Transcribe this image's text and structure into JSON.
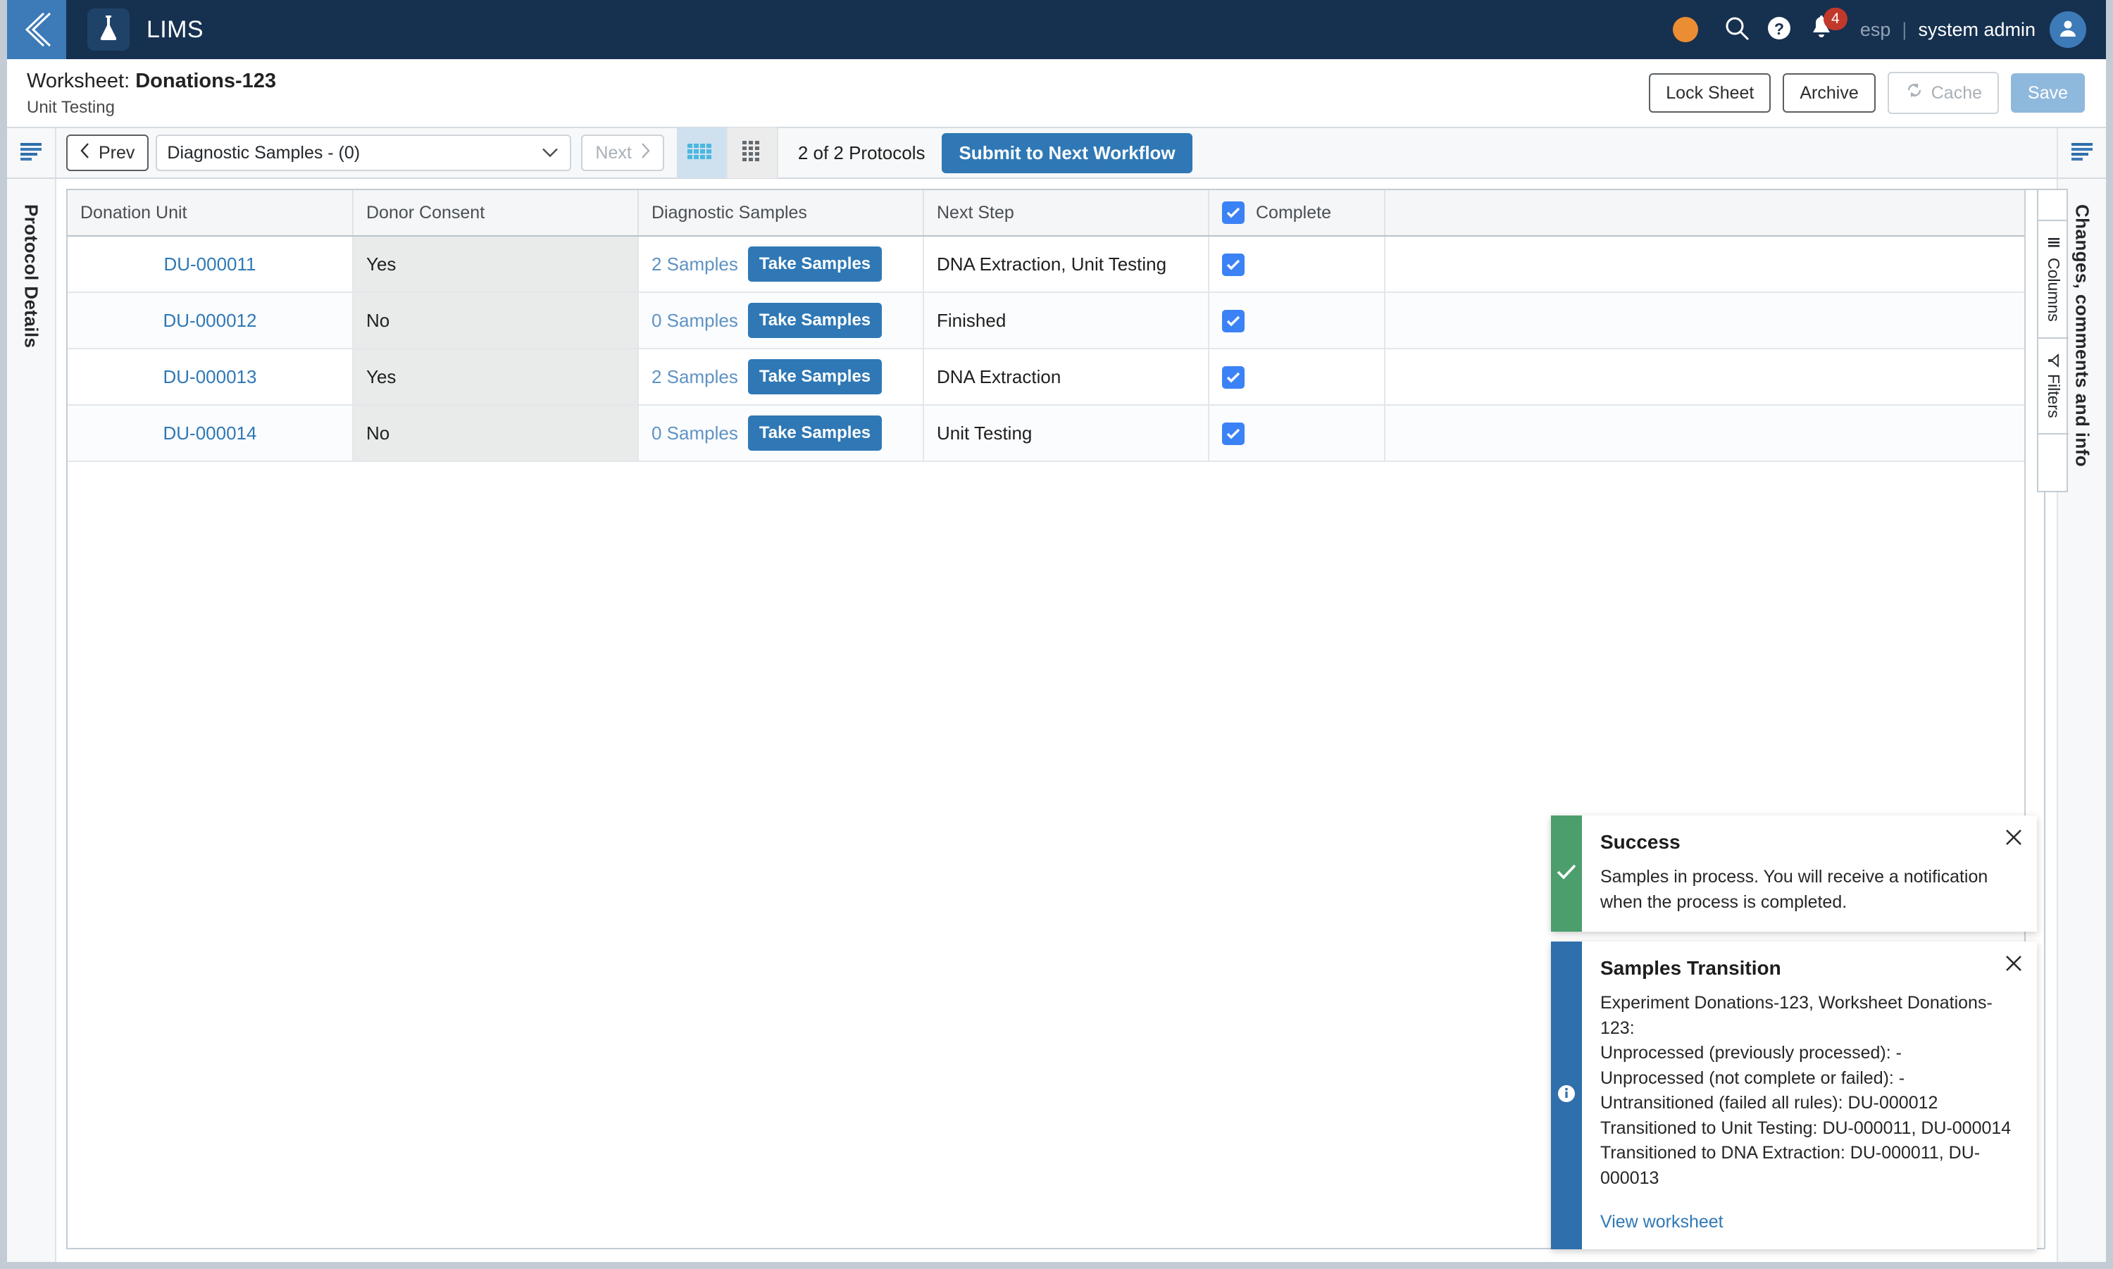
{
  "topnav": {
    "collapse_icon": "chevron-left-icon",
    "brand_icon": "flask-icon",
    "brand": "LIMS",
    "status_dot_color": "#eb8d33",
    "search_icon": "search-icon",
    "help_icon": "help-circle-icon",
    "bell_icon": "bell-icon",
    "notification_count": "4",
    "language": "esp",
    "separator": "|",
    "user": "system admin",
    "avatar_icon": "user-avatar-icon"
  },
  "titlebar": {
    "label": "Worksheet:",
    "name": "Donations-123",
    "subtitle": "Unit Testing",
    "actions": {
      "lock_sheet": "Lock Sheet",
      "archive": "Archive",
      "cache": "Cache",
      "cache_icon": "refresh-icon",
      "save": "Save"
    }
  },
  "toolbar": {
    "left_rail_icon": "menu-lines-icon",
    "prev": "Prev",
    "next": "Next",
    "protocol_select_value": "Diagnostic Samples - (0)",
    "grid_view_icon": "grid-dense-icon",
    "card_view_icon": "grid-dots-icon",
    "protocol_count": "2 of 2 Protocols",
    "submit": "Submit to Next Workflow",
    "right_rail_icon": "menu-lines-icon"
  },
  "left_panel": {
    "label": "Protocol Details"
  },
  "right_panel": {
    "label": "Changes, comments and info"
  },
  "column_tabs": {
    "columns": "Columns",
    "columns_icon": "columns-icon",
    "filters": "Filters",
    "filters_icon": "filter-icon"
  },
  "table": {
    "columns": [
      "Donation Unit",
      "Donor Consent",
      "Diagnostic Samples",
      "Next Step",
      "Complete"
    ],
    "header_complete_checked": true,
    "take_samples_label": "Take Samples",
    "rows": [
      {
        "donation_unit": "DU-000011",
        "donor_consent": "Yes",
        "samples": "2 Samples",
        "next_step": "DNA Extraction, Unit Testing",
        "complete": true
      },
      {
        "donation_unit": "DU-000012",
        "donor_consent": "No",
        "samples": "0 Samples",
        "next_step": "Finished",
        "complete": true
      },
      {
        "donation_unit": "DU-000013",
        "donor_consent": "Yes",
        "samples": "2 Samples",
        "next_step": "DNA Extraction",
        "complete": true
      },
      {
        "donation_unit": "DU-000014",
        "donor_consent": "No",
        "samples": "0 Samples",
        "next_step": "Unit Testing",
        "complete": true
      }
    ]
  },
  "toasts": [
    {
      "kind": "success",
      "title": "Success",
      "message": "Samples in process. You will receive a notification when the process is completed.",
      "close_icon": "close-icon",
      "icon": "check-icon",
      "stripe_color": "#4c9f6d"
    },
    {
      "kind": "info",
      "title": "Samples Transition",
      "message": "Experiment Donations-123, Worksheet Donations-123:\nUnprocessed (previously processed): -\nUnprocessed (not complete or failed): -\nUntransitioned (failed all rules): DU-000012\nTransitioned to Unit Testing: DU-000011, DU-000014\nTransitioned to DNA Extraction: DU-000011, DU-000013",
      "link": "View worksheet",
      "close_icon": "close-icon",
      "icon": "info-icon",
      "stripe_color": "#2f6fab"
    }
  ],
  "colors": {
    "nav_bg": "#16304f",
    "accent_blue": "#2f78b5",
    "checkbox_blue": "#3b82f6",
    "success_green": "#4c9f6d",
    "badge_red": "#c0392b"
  }
}
